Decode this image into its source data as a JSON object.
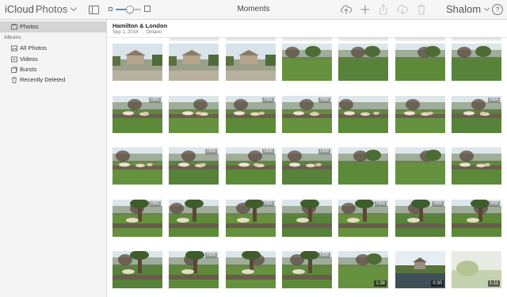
{
  "app": {
    "name_part1": "iCloud",
    "name_part2": "Photos"
  },
  "toolbar": {
    "title": "Moments",
    "user_name": "Shalom",
    "help_label": "?",
    "zoom_level": 0.55
  },
  "sidebar": {
    "top_items": [
      {
        "label": "Photos",
        "icon": "photos-icon",
        "selected": true
      }
    ],
    "albums_header": "Albums",
    "album_items": [
      {
        "label": "All Photos",
        "icon": "all-photos-icon"
      },
      {
        "label": "Videos",
        "icon": "videos-icon"
      },
      {
        "label": "Bursts",
        "icon": "bursts-icon"
      },
      {
        "label": "Recently Deleted",
        "icon": "trash-icon"
      }
    ]
  },
  "moment": {
    "title": "Hamilton & London",
    "date": "Sep 1, 2014",
    "location": "Ontario",
    "separator": "·"
  },
  "photos": [
    {
      "kind": "house",
      "hdr": false,
      "duration": ""
    },
    {
      "kind": "house",
      "hdr": false,
      "duration": ""
    },
    {
      "kind": "house",
      "hdr": false,
      "duration": ""
    },
    {
      "kind": "lawn",
      "hdr": false,
      "duration": ""
    },
    {
      "kind": "lawn",
      "hdr": false,
      "duration": ""
    },
    {
      "kind": "lawn",
      "hdr": false,
      "duration": ""
    },
    {
      "kind": "lawn",
      "hdr": false,
      "duration": ""
    },
    {
      "kind": "dogs",
      "hdr": true,
      "duration": ""
    },
    {
      "kind": "dogs",
      "hdr": false,
      "duration": ""
    },
    {
      "kind": "dogs",
      "hdr": true,
      "duration": ""
    },
    {
      "kind": "dogs",
      "hdr": true,
      "duration": ""
    },
    {
      "kind": "dogs",
      "hdr": false,
      "duration": ""
    },
    {
      "kind": "dogs",
      "hdr": false,
      "duration": ""
    },
    {
      "kind": "dogs",
      "hdr": true,
      "duration": ""
    },
    {
      "kind": "dogs",
      "hdr": false,
      "duration": ""
    },
    {
      "kind": "dogs",
      "hdr": true,
      "duration": ""
    },
    {
      "kind": "dogs",
      "hdr": true,
      "duration": ""
    },
    {
      "kind": "dogs",
      "hdr": true,
      "duration": ""
    },
    {
      "kind": "lawn",
      "hdr": false,
      "duration": ""
    },
    {
      "kind": "lawn",
      "hdr": false,
      "duration": ""
    },
    {
      "kind": "dogs",
      "hdr": false,
      "duration": ""
    },
    {
      "kind": "tree",
      "hdr": true,
      "duration": ""
    },
    {
      "kind": "tree",
      "hdr": false,
      "duration": ""
    },
    {
      "kind": "tree",
      "hdr": true,
      "duration": ""
    },
    {
      "kind": "tree",
      "hdr": false,
      "duration": ""
    },
    {
      "kind": "tree",
      "hdr": true,
      "duration": ""
    },
    {
      "kind": "tree",
      "hdr": true,
      "duration": ""
    },
    {
      "kind": "tree",
      "hdr": true,
      "duration": ""
    },
    {
      "kind": "tree",
      "hdr": false,
      "duration": ""
    },
    {
      "kind": "tree",
      "hdr": true,
      "duration": ""
    },
    {
      "kind": "tree",
      "hdr": false,
      "duration": ""
    },
    {
      "kind": "tree",
      "hdr": true,
      "duration": ""
    },
    {
      "kind": "lawn",
      "hdr": false,
      "duration": "1:38"
    },
    {
      "kind": "pond",
      "hdr": false,
      "duration": "0:30"
    },
    {
      "kind": "bright",
      "hdr": false,
      "duration": "1:11"
    }
  ],
  "labels": {
    "hdr": "HDR"
  },
  "colors": {
    "accent": "#4a90d9",
    "selection": "#d4d4d4",
    "grass": "#5f8a3a",
    "sky": "#dfe8ee"
  }
}
